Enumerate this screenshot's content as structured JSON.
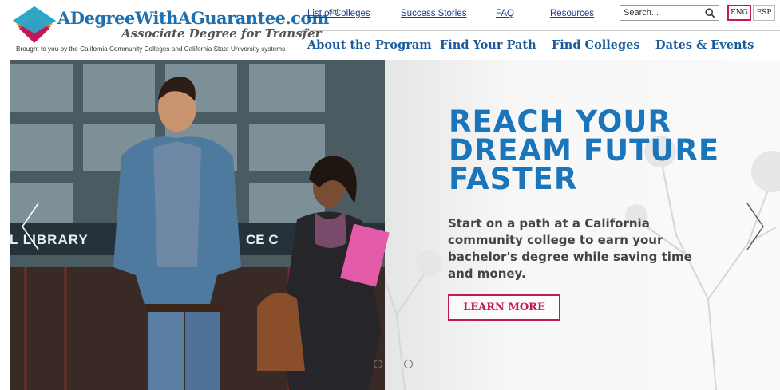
{
  "brand": {
    "name": "ADegreeWithAGuarantee.com",
    "sm": "SM",
    "subtitle": "Associate Degree for Transfer",
    "tagline": "Brought to you by the California Community Colleges and California State University systems",
    "colors": {
      "blue": "#1f6fae",
      "teal": "#2aa7c9",
      "magenta": "#c2185b",
      "yellow": "#f5b400"
    }
  },
  "utility_nav": [
    {
      "label": "List of Colleges"
    },
    {
      "label": "Success Stories"
    },
    {
      "label": "FAQ"
    },
    {
      "label": "Resources"
    }
  ],
  "search": {
    "placeholder": "Search...",
    "icon": "search-icon"
  },
  "languages": [
    {
      "label": "ENG",
      "active": true
    },
    {
      "label": "ESP",
      "active": false
    }
  ],
  "main_nav": [
    {
      "label": "About the Program"
    },
    {
      "label": "Find Your Path"
    },
    {
      "label": "Find Colleges"
    },
    {
      "label": "Dates & Events"
    }
  ],
  "hero": {
    "title_lines": [
      "REACH YOUR",
      "DREAM FUTURE",
      "FASTER"
    ],
    "text": "Start on a path at a California community college to earn your bachelor's degree while saving time and money.",
    "button": "LEARN MORE",
    "sign_left": "L LIBRARY",
    "sign_right": "CE C",
    "title_color": "#1b75bb",
    "slides": 2
  }
}
